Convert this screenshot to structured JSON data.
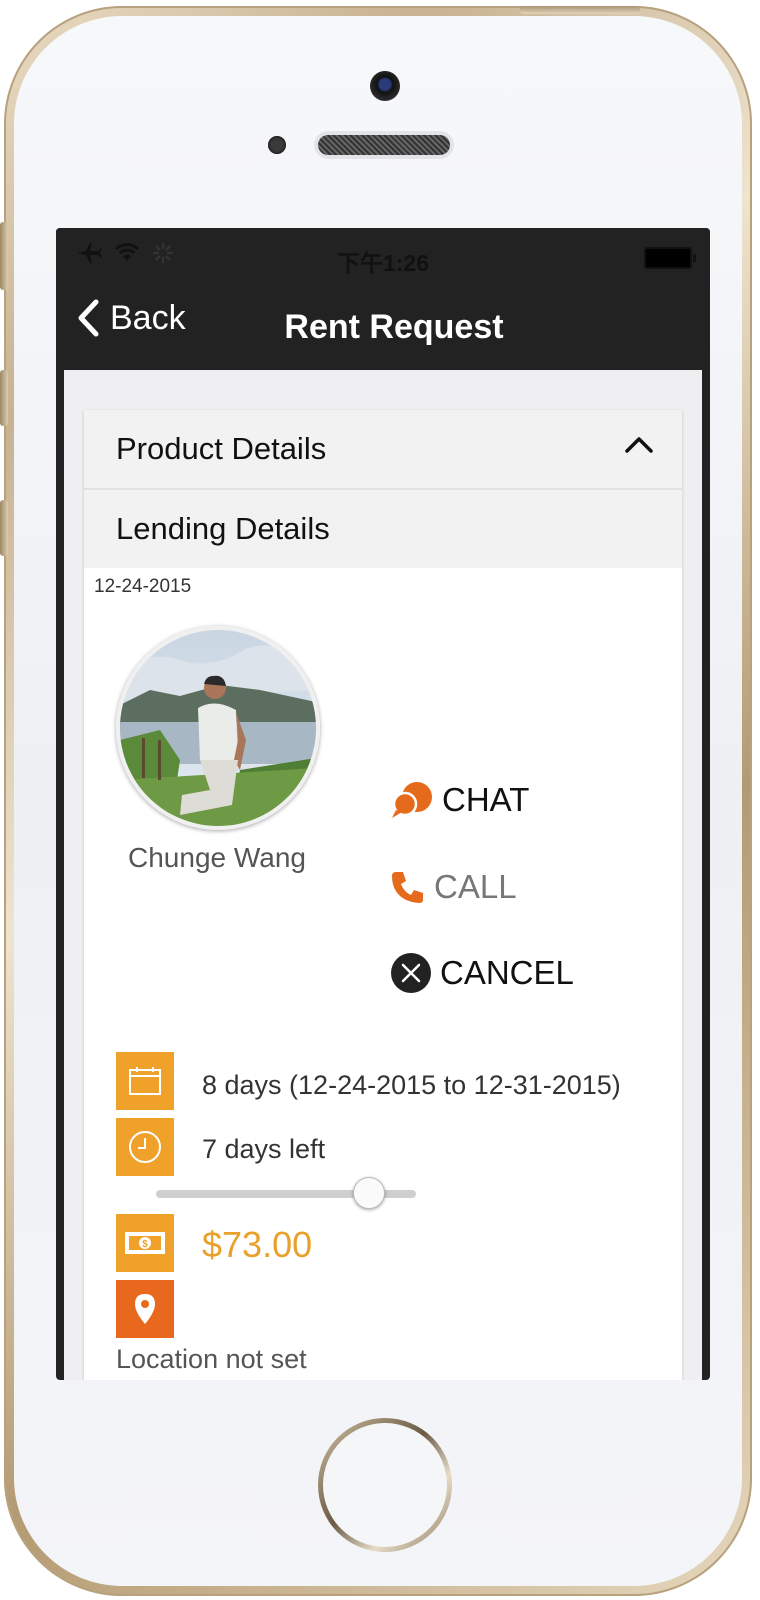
{
  "status_bar": {
    "time": "下午1:26"
  },
  "nav": {
    "back_label": "Back",
    "title": "Rent Request"
  },
  "sections": {
    "product_details": "Product Details",
    "lending_details": "Lending Details"
  },
  "request": {
    "date": "12-24-2015",
    "user_name": "Chunge Wang"
  },
  "actions": {
    "chat": "CHAT",
    "call": "CALL",
    "cancel": "CANCEL"
  },
  "rental": {
    "duration": "8 days (12-24-2015 to 12-31-2015)",
    "time_left": "7 days left",
    "progress_fraction": 0.82,
    "price": "$73.00",
    "location": "Location not set"
  },
  "icons": {
    "calendar": "calendar-icon",
    "clock": "clock-icon",
    "money": "money-icon",
    "location": "location-pin-icon",
    "chat": "chat-bubbles-icon",
    "call": "phone-icon",
    "cancel": "close-circle-icon"
  },
  "colors": {
    "accent_orange": "#f0a12a",
    "location_orange": "#e8691d",
    "chat_orange": "#e66a1c",
    "price": "#e8a12a",
    "nav_bg": "#222222"
  }
}
